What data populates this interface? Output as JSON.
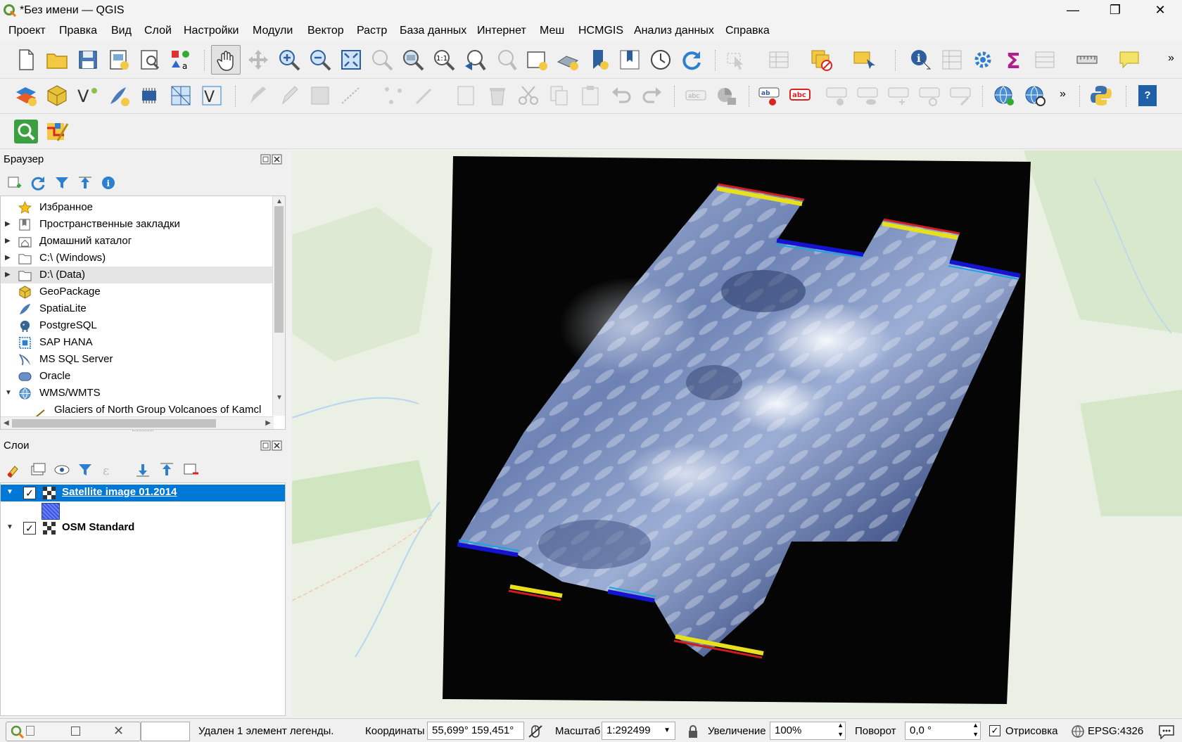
{
  "window": {
    "title": "*Без имени — QGIS",
    "minimize_glyph": "—",
    "maximize_glyph": "❐",
    "close_glyph": "✕"
  },
  "menu": [
    "Проект",
    "Правка",
    "Вид",
    "Слой",
    "Настройки",
    "Модули",
    "Вектор",
    "Растр",
    "База данных",
    "Интернет",
    "Меш",
    "HCMGIS",
    "Анализ данных",
    "Справка"
  ],
  "browser": {
    "title": "Браузер",
    "items": [
      {
        "label": "Избранное",
        "icon": "star-icon",
        "expandable": false
      },
      {
        "label": "Пространственные закладки",
        "icon": "bookmark-icon",
        "expandable": true
      },
      {
        "label": "Домашний каталог",
        "icon": "home-folder-icon",
        "expandable": true
      },
      {
        "label": "C:\\ (Windows)",
        "icon": "folder-icon",
        "expandable": true
      },
      {
        "label": "D:\\ (Data)",
        "icon": "folder-icon",
        "expandable": true
      },
      {
        "label": "GeoPackage",
        "icon": "geopackage-icon",
        "expandable": false
      },
      {
        "label": "SpatiaLite",
        "icon": "spatialite-icon",
        "expandable": false
      },
      {
        "label": "PostgreSQL",
        "icon": "postgresql-icon",
        "expandable": false
      },
      {
        "label": "SAP HANA",
        "icon": "sap-hana-icon",
        "expandable": false
      },
      {
        "label": "MS SQL Server",
        "icon": "mssql-icon",
        "expandable": false
      },
      {
        "label": "Oracle",
        "icon": "oracle-icon",
        "expandable": false
      },
      {
        "label": "WMS/WMTS",
        "icon": "wms-globe-icon",
        "expandable": true
      },
      {
        "label": "Glaciers of North Group Volcanoes of Kamcl",
        "icon": "wms-layer-icon",
        "expandable": false
      }
    ]
  },
  "layers": {
    "title": "Слои",
    "items": [
      {
        "label": "Satellite image 01.2014",
        "checked": true,
        "selected": true
      },
      {
        "label": "OSM Standard",
        "checked": true,
        "selected": false
      }
    ]
  },
  "status": {
    "message": "Удален 1 элемент легенды.",
    "coords_label": "Координаты",
    "coords_value": "55,699° 159,451°",
    "scale_label": "Масштаб",
    "scale_value": "1:292499",
    "zoom_label": "Увеличение",
    "zoom_value": "100%",
    "rotation_label": "Поворот",
    "rotation_value": "0,0 °",
    "render_label": "Отрисовка",
    "crs": "EPSG:4326"
  },
  "colors": {
    "selection": "#0078d7",
    "map_bg": "#e8efe3",
    "raster_nodata": "#050505"
  }
}
